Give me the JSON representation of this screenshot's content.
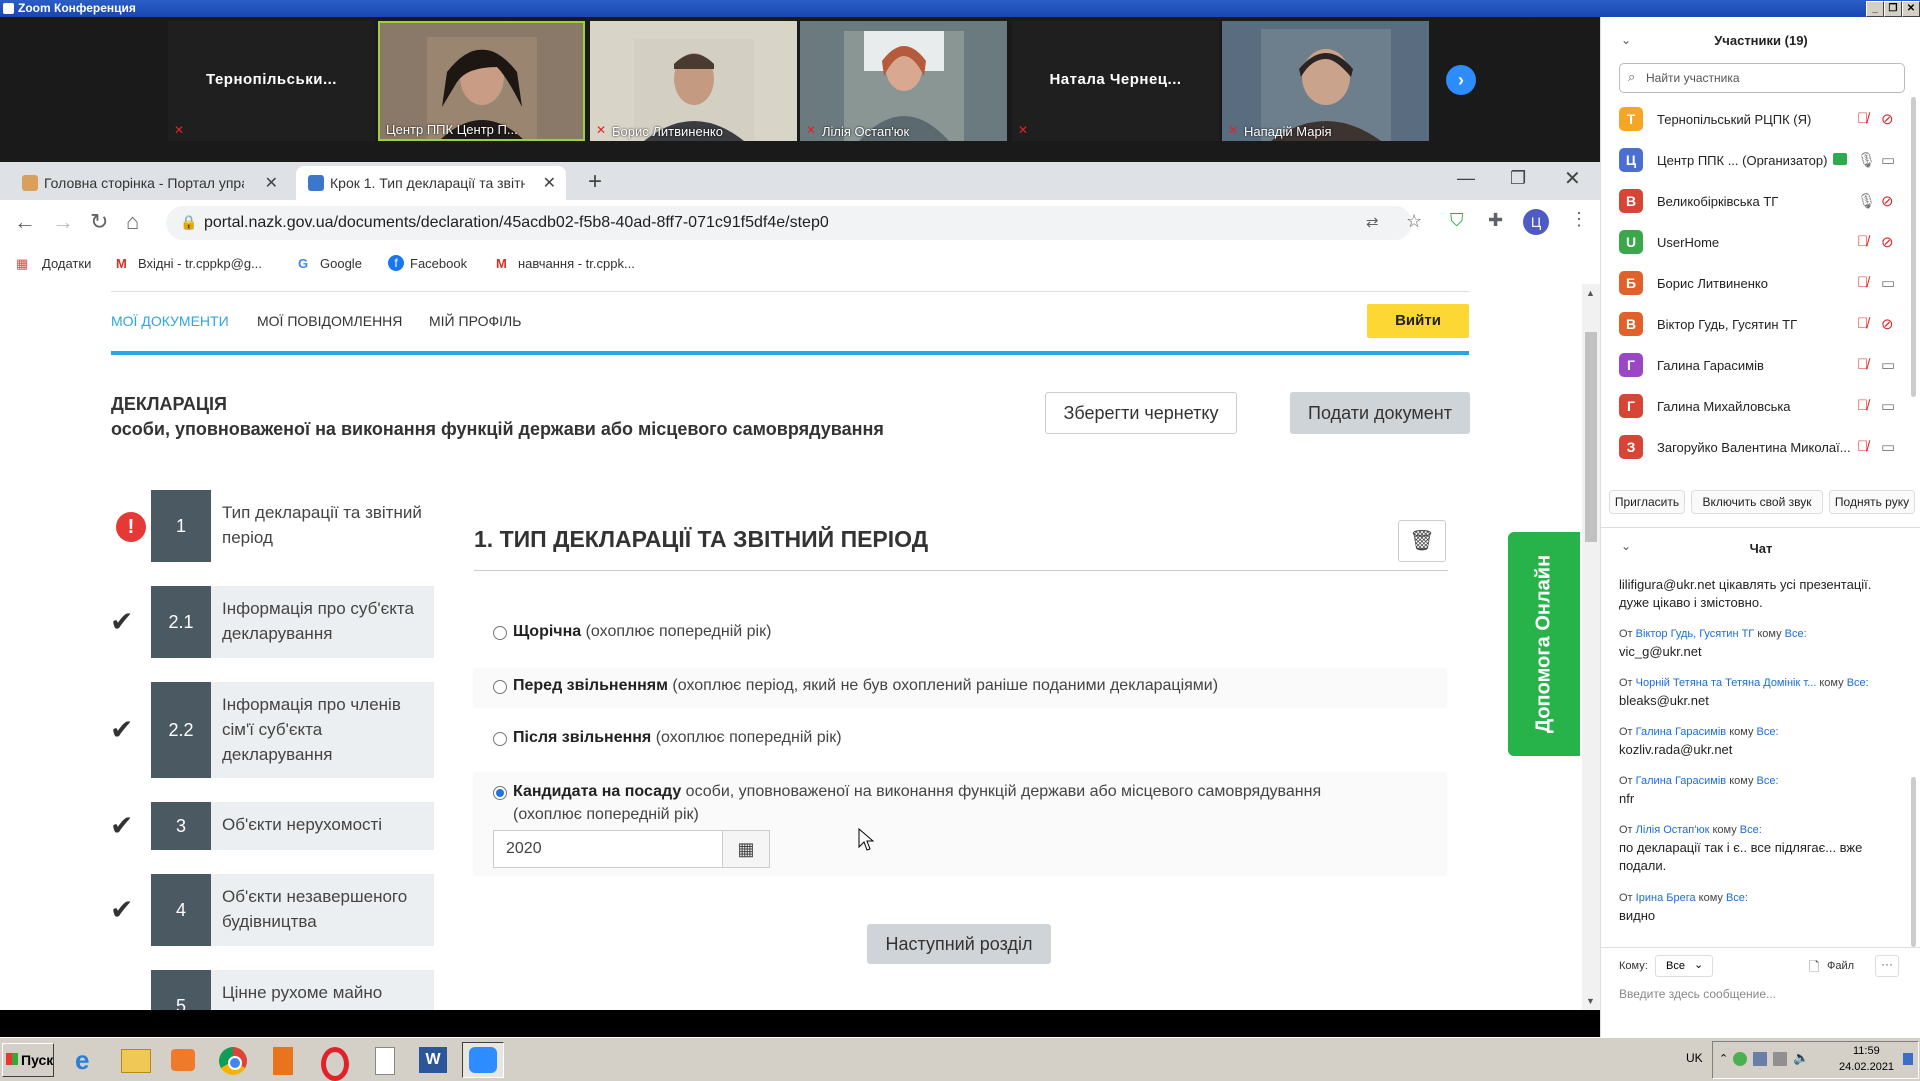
{
  "zoom": {
    "title": "Zoom Конференция",
    "tiles": [
      {
        "name": "Тернопільськи...",
        "has_video": false
      },
      {
        "name": "Центр ППК Центр П...",
        "has_video": true
      },
      {
        "name": "Борис Литвиненко",
        "has_video": true
      },
      {
        "name": "Лілія Остап'юк",
        "has_video": true
      },
      {
        "name": "Натала  Чернец...",
        "has_video": false
      },
      {
        "name": "Нападій Марія",
        "has_video": true
      }
    ]
  },
  "browser": {
    "tabs": [
      {
        "title": "Головна сторінка - Портал упра"
      },
      {
        "title": "Крок 1. Тип декларації та звітн"
      }
    ],
    "url": "portal.nazk.gov.ua/documents/declaration/45acdb02-f5b8-40ad-8ff7-071c91f5df4e/step0",
    "bookmarks": [
      "Додатки",
      "Вхідні - tr.cppkp@g...",
      "Google",
      "Facebook",
      "навчання - tr.cppk..."
    ],
    "profile_letter": "Ц"
  },
  "page": {
    "nav": [
      "МОЇ ДОКУМЕНТИ",
      "МОЇ ПОВІДОМЛЕННЯ",
      "МІЙ ПРОФІЛЬ"
    ],
    "exit_label": "Вийти",
    "decl_title": "ДЕКЛАРАЦІЯ",
    "decl_subtitle": "особи, уповноваженої на виконання функцій держави або місцевого самоврядування",
    "save_draft": "Зберегти чернетку",
    "submit": "Подати документ",
    "steps": [
      {
        "num": "1",
        "label": "Тип декларації та звітний період"
      },
      {
        "num": "2.1",
        "label": "Інформація про суб'єкта декларування"
      },
      {
        "num": "2.2",
        "label": "Інформація про членів сім'ї суб'єкта декларування"
      },
      {
        "num": "3",
        "label": "Об'єкти нерухомості"
      },
      {
        "num": "4",
        "label": "Об'єкти незавершеного будівництва"
      },
      {
        "num": "5",
        "label": "Цінне рухоме майно"
      }
    ],
    "section_title": "1.  ТИП ДЕКЛАРАЦІЇ ТА ЗВІТНИЙ ПЕРІОД",
    "options": [
      {
        "bold": "Щорічна",
        "rest": " (охоплює попередній рік)",
        "checked": false
      },
      {
        "bold": "Перед звільненням",
        "rest": " (охоплює період, який не був охоплений раніше поданими деклараціями)",
        "checked": false
      },
      {
        "bold": "Після звільнення",
        "rest": " (охоплює попередній рік)",
        "checked": false
      },
      {
        "bold": "Кандидата на посаду",
        "rest": " особи, уповноваженої на виконання функцій держави або місцевого самоврядування",
        "rest2": "(охоплює попередній рік)",
        "checked": true
      }
    ],
    "year_value": "2020",
    "next_section": "Наступний розділ",
    "help_online": "Допомога Онлайн"
  },
  "panel": {
    "participants_header": "Участники (19)",
    "search_placeholder": "Найти участника",
    "participants": [
      {
        "letter": "T",
        "color": "#f5a623",
        "name": "Тернопільський РЦПК (Я)"
      },
      {
        "letter": "Ц",
        "color": "#4a6fd1",
        "name": "Центр ППК ... (Организатор)"
      },
      {
        "letter": "В",
        "color": "#d64535",
        "name": "Великобірківська ТГ"
      },
      {
        "letter": "U",
        "color": "#3aa84a",
        "name": "UserHome"
      },
      {
        "letter": "Б",
        "color": "#e0622a",
        "name": "Борис Литвиненко"
      },
      {
        "letter": "В",
        "color": "#e0622a",
        "name": "Віктор Гудь, Гусятин ТГ"
      },
      {
        "letter": "Г",
        "color": "#9b47c5",
        "name": "Галина Гарасимів"
      },
      {
        "letter": "Г",
        "color": "#d64535",
        "name": "Галина Михайловська"
      },
      {
        "letter": "З",
        "color": "#d64535",
        "name": "Загоруйко Валентина Миколаї..."
      }
    ],
    "buttons": [
      "Пригласить",
      "Включить свой звук",
      "Поднять руку"
    ],
    "chat_header": "Чат",
    "messages": [
      {
        "from": "",
        "to": "",
        "text": "lilifigura@ukr.net цікавлять усі презентації. дуже цікаво і змістовно."
      },
      {
        "from": "Віктор Гудь, Гусятин ТГ",
        "to": "Все:",
        "text": "vic_g@ukr.net"
      },
      {
        "from": "Чорній Тетяна та Тетяна Домінік т...",
        "to": "Все:",
        "text": "bleaks@ukr.net"
      },
      {
        "from": "Галина Гарасимів",
        "to": "Все:",
        "text": "kozliv.rada@ukr.net"
      },
      {
        "from": "Галина Гарасимів",
        "to": "Все:",
        "text": "nfr"
      },
      {
        "from": "Лілія Остап'юк",
        "to": "Все:",
        "text": "по декларації так і є.. все підлягає... вже подали."
      },
      {
        "from": "Ірина Брега",
        "to": "Все:",
        "text": "видно"
      }
    ],
    "from_word": "От",
    "to_word": "кому",
    "to_label": "Кому:",
    "to_value": "Все",
    "file_label": "Файл",
    "input_placeholder": "Введите здесь сообщение..."
  },
  "taskbar": {
    "start_label": "Пуск",
    "lang": "UK",
    "time": "11:59",
    "date": "24.02.2021"
  }
}
